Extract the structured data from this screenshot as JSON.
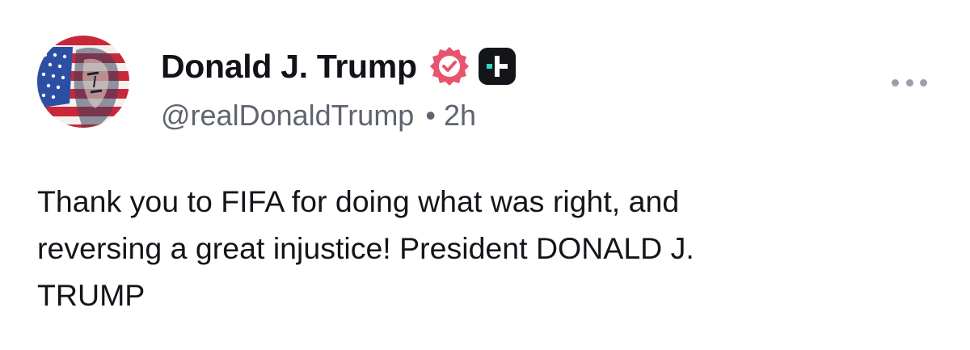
{
  "post": {
    "author": {
      "display_name": "Donald J. Trump",
      "handle": "@realDonaldTrump",
      "avatar_icon": "flag-portrait-avatar",
      "verified_icon": "verified-badge-icon",
      "verified_color": "#e8546e",
      "plus_icon": "plus-badge-icon",
      "plus_color": "#14151a",
      "plus_accent": "#2ed8c3"
    },
    "separator": "•",
    "timestamp": "2h",
    "more_icon": "more-options-icon",
    "text": "Thank you to FIFA for doing what was right, and\nreversing a great injustice! President DONALD J.\nTRUMP"
  }
}
